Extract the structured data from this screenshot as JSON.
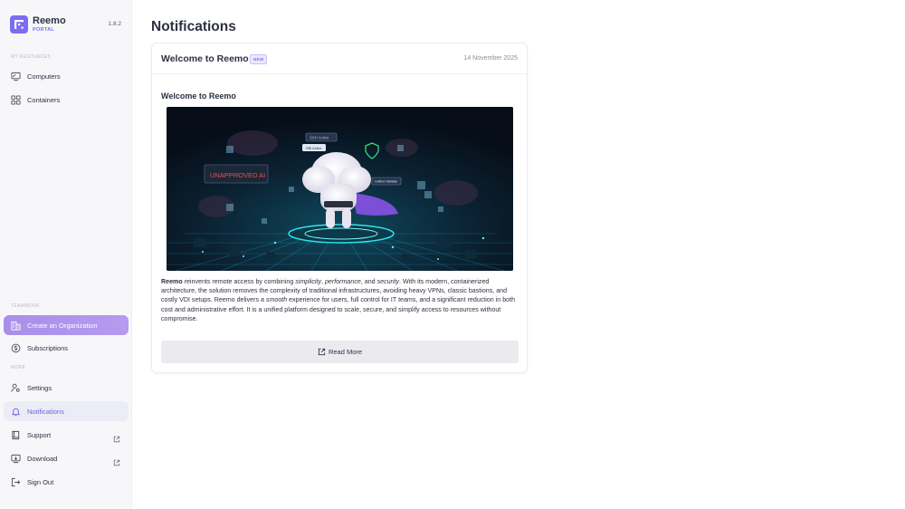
{
  "app": {
    "name": "Reemo",
    "subtitle": "PORTAL",
    "version": "1.8.2"
  },
  "sidebar": {
    "sections": {
      "my_resources": "MY RESOURCES",
      "teamwork": "TEAMWORK",
      "more": "MORE"
    },
    "items": {
      "computers": "Computers",
      "containers": "Containers",
      "create_org": "Create an Organization",
      "subscriptions": "Subscriptions",
      "settings": "Settings",
      "notifications": "Notifications",
      "support": "Support",
      "download": "Download",
      "sign_out": "Sign Out"
    }
  },
  "main": {
    "page_title": "Notifications",
    "notification": {
      "title": "Welcome to Reemo",
      "badge": "NEW",
      "date": "14 November 2025",
      "content_title": "Welcome to Reemo",
      "hero_label": "UNAPPROVED AI",
      "hero_chip_1": "SSH Active",
      "hero_chip_2": "RBI Active",
      "hero_chip_3": "Unified Validate",
      "body": {
        "p1": "Reemo",
        "p2": " reinvents remote access by combining ",
        "p3": "simplicity",
        "p4": ", ",
        "p5": "performance",
        "p6": ", and ",
        "p7": "security",
        "p8": ". With its modern, containerized architecture, the solution removes the complexity of traditional infrastructures, avoiding heavy VPNs, classic bastions, and costly VDI setups. Reemo delivers a ",
        "p9": "smooth",
        "p10": " experience for users, full control for IT teams, and a significant reduction in both cost and administrative effort. It is a unified platform designed to scale, secure, and simplify access to resources without compromise."
      },
      "read_more": "Read More"
    }
  },
  "colors": {
    "accent": "#7c6cf0",
    "active_gradient_start": "#a88fe8",
    "selected_bg": "#ececf6"
  },
  "icons": {
    "logo": "reemo-logo-icon",
    "computers": "monitor-icon",
    "containers": "grid-icon",
    "create_org": "building-icon",
    "subscriptions": "dollar-cycle-icon",
    "settings": "settings-user-icon",
    "notifications": "bell-icon",
    "support": "book-icon",
    "download": "download-icon",
    "sign_out": "logout-icon",
    "external": "external-link-icon",
    "read_more": "external-link-icon"
  }
}
